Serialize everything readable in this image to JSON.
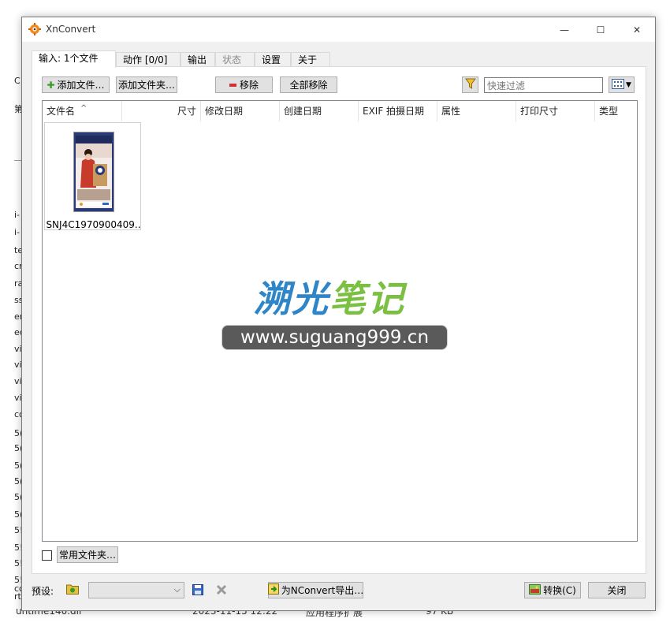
{
  "background": {
    "left_fragments": [
      "C",
      "第",
      "i-",
      "i-",
      "te",
      "cr",
      "ra",
      "ss",
      "er",
      "ec",
      "vi",
      "vi",
      "vi",
      "vi",
      "cc",
      "5(",
      "5(",
      "5(",
      "5(",
      "5(",
      "5(",
      "5!",
      "5!",
      "5!",
      "5!",
      "rt",
      "cc"
    ],
    "bottom_row": {
      "name": "untime140.dll",
      "date": "2023-11-15 12:22",
      "type": "应用程序扩展",
      "size": "97 KB"
    }
  },
  "window": {
    "title": "XnConvert",
    "controls": {
      "minimize": "—",
      "maximize": "☐",
      "close": "✕"
    }
  },
  "tabs": [
    {
      "label": "输入: 1个文件",
      "active": true,
      "disabled": false
    },
    {
      "label": "动作 [0/0]",
      "active": false,
      "disabled": false
    },
    {
      "label": "输出",
      "active": false,
      "disabled": false
    },
    {
      "label": "状态",
      "active": false,
      "disabled": true
    },
    {
      "label": "设置",
      "active": false,
      "disabled": false
    },
    {
      "label": "关于",
      "active": false,
      "disabled": false
    }
  ],
  "toolbar": {
    "add_files": "添加文件…",
    "add_folder": "添加文件夹…",
    "remove": "移除",
    "remove_all": "全部移除",
    "filter_placeholder": "快速过滤"
  },
  "columns": [
    "文件名",
    "尺寸",
    "修改日期",
    "创建日期",
    "EXIF 拍摄日期",
    "属性",
    "打印尺寸",
    "类型"
  ],
  "files": [
    {
      "name": "SNJ4C1970900409.."
    }
  ],
  "watermark": {
    "title_part1": "溯光",
    "title_part2": "笔记",
    "url": "www.suguang999.cn"
  },
  "common_folder_label": "常用文件夹…",
  "footer": {
    "preset_label": "预设:",
    "preset_value": "",
    "export_label": "为NConvert导出…",
    "convert_label": "转换(C)",
    "close_label": "关闭"
  },
  "colors": {
    "accent_blue": "#2e86c8",
    "accent_green": "#7cc043",
    "window_bg": "#f0f0f0"
  }
}
